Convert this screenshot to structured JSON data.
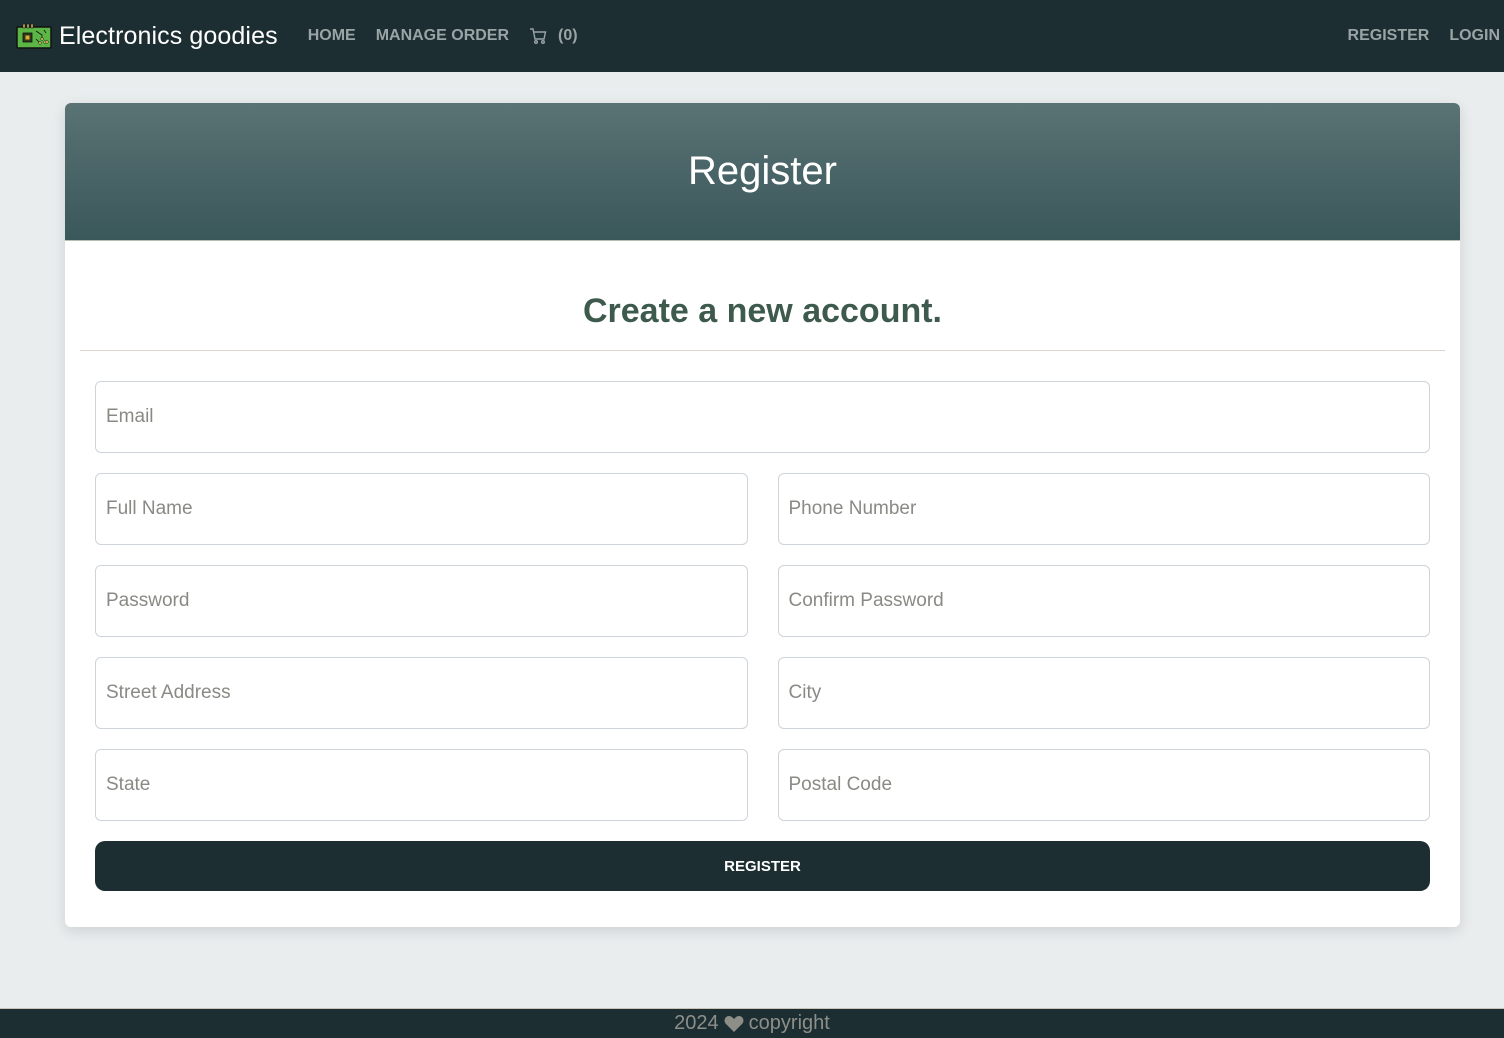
{
  "navbar": {
    "brand_icon": "circuit-board-icon",
    "brand_name": "Electronics goodies",
    "links": [
      {
        "label": "HOME"
      },
      {
        "label": "MANAGE ORDER"
      }
    ],
    "cart": {
      "icon": "cart-icon",
      "count_label": "(0)"
    },
    "right_links": [
      {
        "label": "REGISTER"
      },
      {
        "label": "LOGIN"
      }
    ]
  },
  "card": {
    "title": "Register",
    "subtitle": "Create a new account.",
    "fields": {
      "email": {
        "placeholder": "Email",
        "value": ""
      },
      "full_name": {
        "placeholder": "Full Name",
        "value": ""
      },
      "phone": {
        "placeholder": "Phone Number",
        "value": ""
      },
      "password": {
        "placeholder": "Password",
        "value": ""
      },
      "confirm_password": {
        "placeholder": "Confirm Password",
        "value": ""
      },
      "street": {
        "placeholder": "Street Address",
        "value": ""
      },
      "city": {
        "placeholder": "City",
        "value": ""
      },
      "state": {
        "placeholder": "State",
        "value": ""
      },
      "postal": {
        "placeholder": "Postal Code",
        "value": ""
      }
    },
    "submit_label": "REGISTER"
  },
  "footer": {
    "year": "2024",
    "icon": "heart-icon",
    "text": "copyright"
  },
  "colors": {
    "navbar_bg": "#1c2e32",
    "header_gradient_top": "#5a7375",
    "header_gradient_bottom": "#3a5759",
    "subtitle": "#3d5a4c",
    "page_bg": "#e9edee"
  }
}
